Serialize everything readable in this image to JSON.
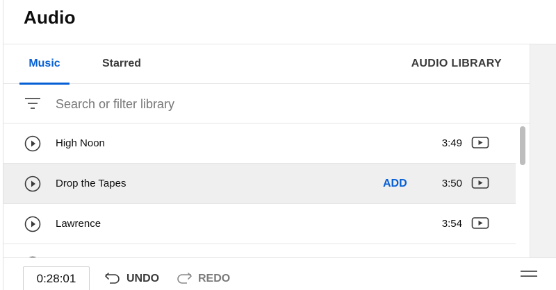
{
  "page": {
    "title": "Audio"
  },
  "tabs": [
    {
      "label": "Music",
      "active": true
    },
    {
      "label": "Starred",
      "active": false
    }
  ],
  "audio_library_label": "AUDIO LIBRARY",
  "search": {
    "placeholder": "Search or filter library"
  },
  "tracks": [
    {
      "title": "High Noon",
      "duration": "3:49"
    },
    {
      "title": "Drop the Tapes",
      "duration": "3:50",
      "action": "ADD"
    },
    {
      "title": "Lawrence",
      "duration": "3:54"
    }
  ],
  "footer": {
    "timecode": "0:28:01",
    "undo_label": "UNDO",
    "redo_label": "REDO"
  },
  "colors": {
    "accent": "#065fd4",
    "row_highlight": "#efefef",
    "divider": "#e5e5e5"
  },
  "icons": {
    "filter": "filter-icon",
    "play": "play-circle-icon",
    "video": "video-preview-icon",
    "undo": "undo-arrow-icon",
    "redo": "redo-arrow-icon",
    "menu": "hamburger-menu-icon"
  }
}
